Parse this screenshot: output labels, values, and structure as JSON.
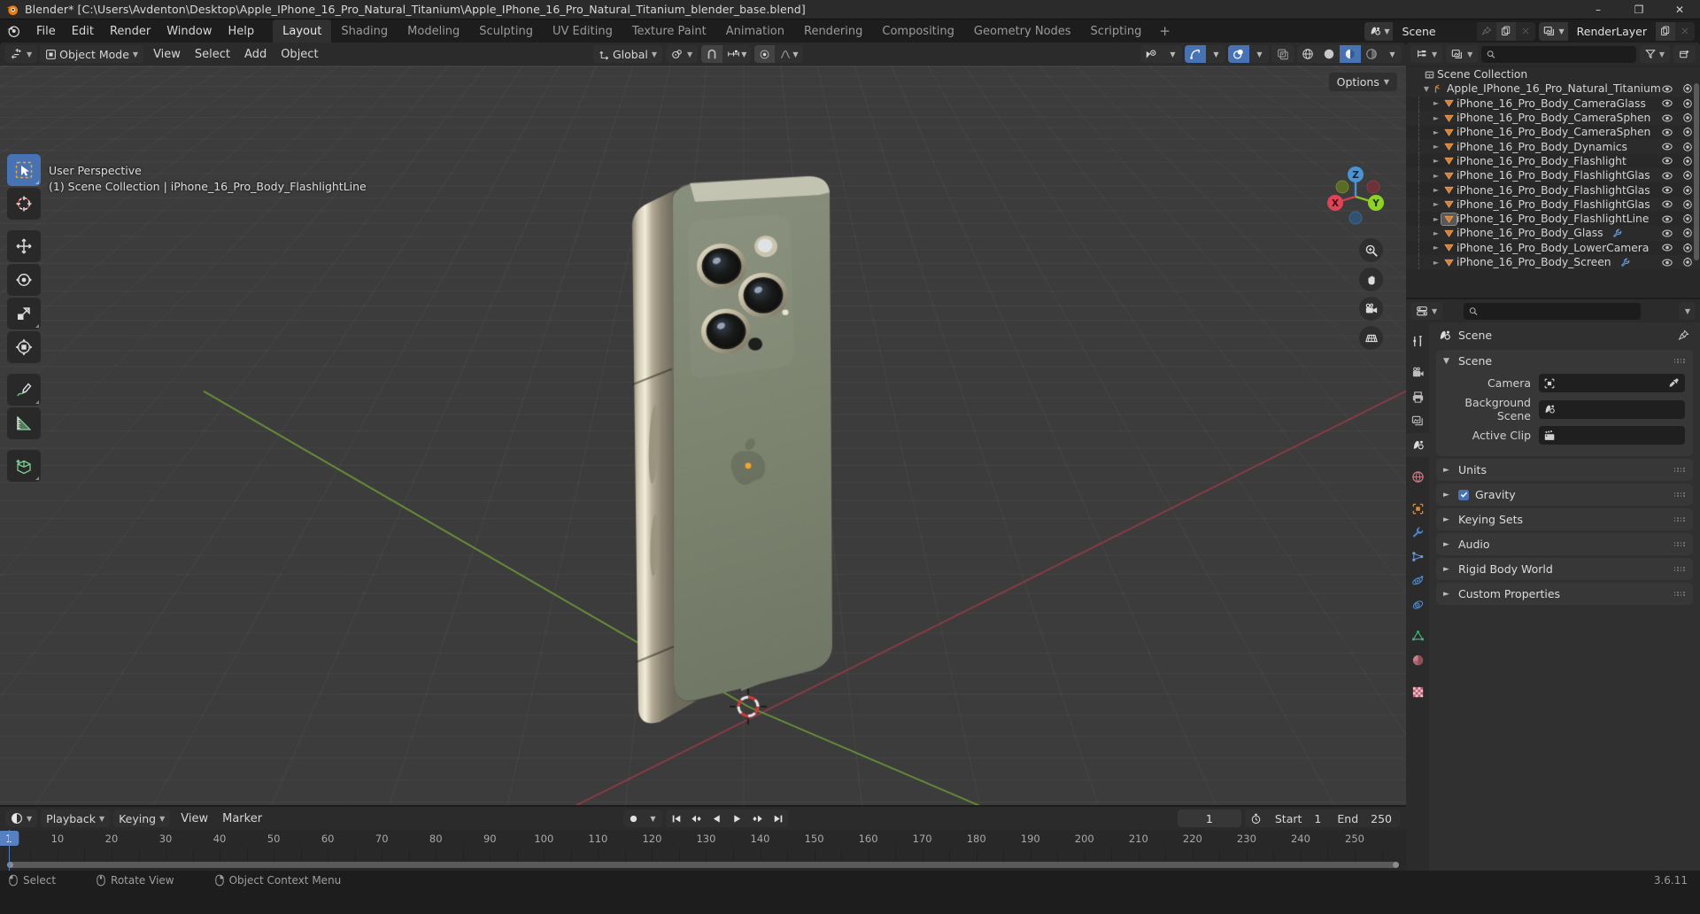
{
  "titlebar": {
    "text": "Blender* [C:\\Users\\Avdenton\\Desktop\\Apple_IPhone_16_Pro_Natural_Titanium\\Apple_IPhone_16_Pro_Natural_Titanium_blender_base.blend]",
    "minimize": "–",
    "maximize": "❐",
    "close": "✕"
  },
  "topbar": {
    "menus": [
      "File",
      "Edit",
      "Render",
      "Window",
      "Help"
    ],
    "workspaces": [
      {
        "label": "Layout",
        "active": true
      },
      {
        "label": "Shading",
        "active": false
      },
      {
        "label": "Modeling",
        "active": false
      },
      {
        "label": "Sculpting",
        "active": false
      },
      {
        "label": "UV Editing",
        "active": false
      },
      {
        "label": "Texture Paint",
        "active": false
      },
      {
        "label": "Animation",
        "active": false
      },
      {
        "label": "Rendering",
        "active": false
      },
      {
        "label": "Compositing",
        "active": false
      },
      {
        "label": "Geometry Nodes",
        "active": false
      },
      {
        "label": "Scripting",
        "active": false
      }
    ],
    "add_workspace": "+",
    "scene_name": "Scene",
    "viewlayer_name": "RenderLayer"
  },
  "viewport_header": {
    "mode": "Object Mode",
    "menus": [
      "View",
      "Select",
      "Add",
      "Object"
    ],
    "transform_orientation": "Global",
    "options_label": "Options"
  },
  "viewport": {
    "overlay_line1": "User Perspective",
    "overlay_line2": "(1) Scene Collection | iPhone_16_Pro_Body_FlashlightLine",
    "gizmo_axes": [
      "X",
      "Y",
      "Z"
    ],
    "background_color": "#3c3c3c",
    "grid_color": "#4a4a4a",
    "axis_x_color": "#9c3b4a",
    "axis_y_color": "#6f9c38"
  },
  "toolbar": [
    {
      "name": "tweak-select-box",
      "active": true
    },
    {
      "name": "cursor",
      "active": false
    },
    {
      "name": "move",
      "active": false
    },
    {
      "name": "rotate",
      "active": false
    },
    {
      "name": "scale",
      "active": false
    },
    {
      "name": "transform",
      "active": false
    },
    {
      "name": "annotate",
      "active": false
    },
    {
      "name": "measure",
      "active": false
    },
    {
      "name": "add-cube",
      "active": false
    }
  ],
  "outliner": {
    "root": "Scene Collection",
    "items": [
      {
        "label": "Apple_IPhone_16_Pro_Natural_Titanium",
        "depth": 1,
        "icon": "collection",
        "expanded": true,
        "selected": false,
        "modifier": false
      },
      {
        "label": "iPhone_16_Pro_Body_CameraGlass",
        "depth": 2,
        "icon": "mesh",
        "expanded": false,
        "selected": false,
        "modifier": false
      },
      {
        "label": "iPhone_16_Pro_Body_CameraSphen",
        "depth": 2,
        "icon": "mesh",
        "expanded": false,
        "selected": false,
        "modifier": false
      },
      {
        "label": "iPhone_16_Pro_Body_CameraSphen",
        "depth": 2,
        "icon": "mesh",
        "expanded": false,
        "selected": false,
        "modifier": false
      },
      {
        "label": "iPhone_16_Pro_Body_Dynamics",
        "depth": 2,
        "icon": "mesh",
        "expanded": false,
        "selected": false,
        "modifier": false
      },
      {
        "label": "iPhone_16_Pro_Body_Flashlight",
        "depth": 2,
        "icon": "mesh",
        "expanded": false,
        "selected": false,
        "modifier": false
      },
      {
        "label": "iPhone_16_Pro_Body_FlashlightGlas",
        "depth": 2,
        "icon": "mesh",
        "expanded": false,
        "selected": false,
        "modifier": false
      },
      {
        "label": "iPhone_16_Pro_Body_FlashlightGlas",
        "depth": 2,
        "icon": "mesh",
        "expanded": false,
        "selected": false,
        "modifier": false
      },
      {
        "label": "iPhone_16_Pro_Body_FlashlightGlas",
        "depth": 2,
        "icon": "mesh",
        "expanded": false,
        "selected": false,
        "modifier": false
      },
      {
        "label": "iPhone_16_Pro_Body_FlashlightLine",
        "depth": 2,
        "icon": "mesh",
        "expanded": false,
        "selected": true,
        "modifier": false
      },
      {
        "label": "iPhone_16_Pro_Body_Glass",
        "depth": 2,
        "icon": "mesh",
        "expanded": false,
        "selected": false,
        "modifier": true
      },
      {
        "label": "iPhone_16_Pro_Body_LowerCamera",
        "depth": 2,
        "icon": "mesh",
        "expanded": false,
        "selected": false,
        "modifier": false
      },
      {
        "label": "iPhone_16_Pro_Body_Screen",
        "depth": 2,
        "icon": "mesh",
        "expanded": false,
        "selected": false,
        "modifier": true
      }
    ],
    "search_placeholder": ""
  },
  "properties": {
    "breadcrumb": "Scene",
    "tabs": [
      {
        "name": "tool",
        "active": false
      },
      {
        "name": "render",
        "active": false
      },
      {
        "name": "output",
        "active": false
      },
      {
        "name": "view-layer",
        "active": false
      },
      {
        "name": "scene",
        "active": true
      },
      {
        "name": "world",
        "active": false
      },
      {
        "name": "object",
        "active": false
      },
      {
        "name": "modifiers",
        "active": false
      },
      {
        "name": "particles",
        "active": false
      },
      {
        "name": "physics",
        "active": false
      },
      {
        "name": "constraints",
        "active": false
      },
      {
        "name": "data",
        "active": false
      },
      {
        "name": "material",
        "active": false
      },
      {
        "name": "texture",
        "active": false
      }
    ],
    "scene_panel": {
      "title": "Scene",
      "expanded": true,
      "rows": [
        {
          "label": "Camera",
          "value": "",
          "icon": "camera-data",
          "eyedropper": true
        },
        {
          "label": "Background Scene",
          "value": "",
          "icon": "scene-data",
          "eyedropper": false
        },
        {
          "label": "Active Clip",
          "value": "",
          "icon": "clip-data",
          "eyedropper": false
        }
      ]
    },
    "panels": [
      {
        "title": "Units",
        "expanded": false,
        "checkbox": null
      },
      {
        "title": "Gravity",
        "expanded": false,
        "checkbox": true
      },
      {
        "title": "Keying Sets",
        "expanded": false,
        "checkbox": null
      },
      {
        "title": "Audio",
        "expanded": false,
        "checkbox": null
      },
      {
        "title": "Rigid Body World",
        "expanded": false,
        "checkbox": null
      },
      {
        "title": "Custom Properties",
        "expanded": false,
        "checkbox": null
      }
    ]
  },
  "timeline": {
    "menus": [
      "View",
      "Marker"
    ],
    "playback_label": "Playback",
    "keying_label": "Keying",
    "current_frame": "1",
    "start_label": "Start",
    "start_value": "1",
    "end_label": "End",
    "end_value": "250",
    "ticks": [
      10,
      20,
      30,
      40,
      50,
      60,
      70,
      80,
      90,
      100,
      110,
      120,
      130,
      140,
      150,
      160,
      170,
      180,
      190,
      200,
      210,
      220,
      230,
      240,
      250
    ],
    "frame_range": [
      1,
      250
    ]
  },
  "statusbar": {
    "items": [
      {
        "label": "Select",
        "mouse": "left"
      },
      {
        "label": "Rotate View",
        "mouse": "middle"
      },
      {
        "label": "Object Context Menu",
        "mouse": "right"
      }
    ],
    "version": "3.6.11"
  }
}
